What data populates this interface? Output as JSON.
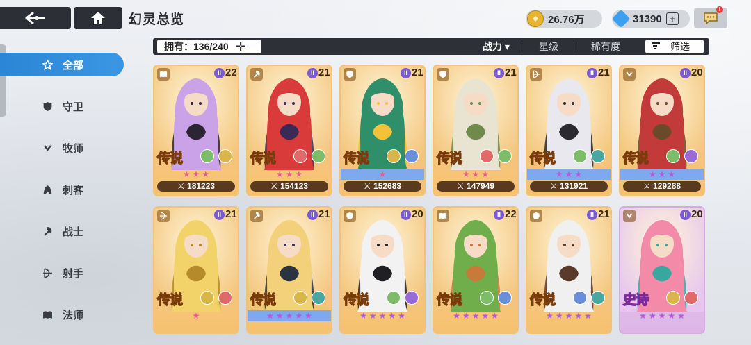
{
  "header": {
    "title": "幻灵总览",
    "gold": "26.76万",
    "gems": "31390",
    "notification_mark": "!"
  },
  "sidebar": {
    "items": [
      {
        "label": "全部",
        "icon": "star-outline-icon",
        "active": true
      },
      {
        "label": "守卫",
        "icon": "shield-icon",
        "active": false
      },
      {
        "label": "牧师",
        "icon": "wings-icon",
        "active": false
      },
      {
        "label": "刺客",
        "icon": "hood-icon",
        "active": false
      },
      {
        "label": "战士",
        "icon": "axe-icon",
        "active": false
      },
      {
        "label": "射手",
        "icon": "bow-icon",
        "active": false
      },
      {
        "label": "法师",
        "icon": "book-icon",
        "active": false
      }
    ]
  },
  "filter_bar": {
    "own_label": "拥有：136/240",
    "sort_options": [
      {
        "label": "战力 ▾",
        "active": true
      },
      {
        "label": "星级",
        "active": false
      },
      {
        "label": "稀有度",
        "active": false
      }
    ],
    "filter_label": "筛选"
  },
  "colors": {
    "accent_blue": "#2a86d6",
    "legend_card": "#f6c170",
    "epic_card": "#dcb6e6",
    "pink_star": "#e85a8a",
    "purple_star": "#b45ad8"
  },
  "cards": [
    {
      "level": "22",
      "rarity": "传说",
      "power": "181223",
      "stars": 3,
      "star_color": "pink",
      "strip": "plain",
      "cls_icon": "book-icon",
      "elements": [
        "leaf",
        "wings"
      ],
      "palette": [
        "#c9a2e8",
        "#2b2433"
      ]
    },
    {
      "level": "21",
      "rarity": "传说",
      "power": "154123",
      "stars": 3,
      "star_color": "pink",
      "strip": "plain",
      "cls_icon": "axe-icon",
      "elements": [
        "spiral",
        "leaf"
      ],
      "palette": [
        "#d93b3b",
        "#3a2a55"
      ]
    },
    {
      "level": "21",
      "rarity": "传说",
      "power": "152683",
      "stars": 1,
      "star_color": "pink",
      "strip": "blue",
      "cls_icon": "shield-icon",
      "elements": [
        "wings",
        "gear"
      ],
      "palette": [
        "#2f8f6a",
        "#f1c23a"
      ]
    },
    {
      "level": "21",
      "rarity": "传说",
      "power": "147949",
      "stars": 3,
      "star_color": "pink",
      "strip": "plain",
      "cls_icon": "shield-icon",
      "elements": [
        "spiral",
        "leaf"
      ],
      "palette": [
        "#e9e4d2",
        "#6f8a4a"
      ]
    },
    {
      "level": "21",
      "rarity": "传说",
      "power": "131921",
      "stars": 3,
      "star_color": "purple",
      "strip": "blue",
      "cls_icon": "bow-icon",
      "elements": [
        "leaf",
        "orb"
      ],
      "palette": [
        "#e8e8ee",
        "#2a2a30"
      ]
    },
    {
      "level": "20",
      "rarity": "传说",
      "power": "129288",
      "stars": 3,
      "star_color": "purple",
      "strip": "blue",
      "cls_icon": "wings-icon",
      "elements": [
        "leaf",
        "eye"
      ],
      "palette": [
        "#c23a3a",
        "#6a4a2a"
      ]
    },
    {
      "level": "21",
      "rarity": "传说",
      "power": "",
      "stars": 1,
      "star_color": "pink",
      "strip": "plain",
      "cls_icon": "bow-icon",
      "elements": [
        "wings",
        "spiral"
      ],
      "palette": [
        "#f1d36a",
        "#b48a2a"
      ]
    },
    {
      "level": "21",
      "rarity": "传说",
      "power": "",
      "stars": 5,
      "star_color": "purple",
      "strip": "blue",
      "cls_icon": "axe-icon",
      "elements": [
        "wings",
        "orb"
      ],
      "palette": [
        "#f3d07a",
        "#2c3340"
      ]
    },
    {
      "level": "20",
      "rarity": "传说",
      "power": "",
      "stars": 5,
      "star_color": "purple",
      "strip": "plain",
      "cls_icon": "shield-icon",
      "elements": [
        "leaf",
        "eye"
      ],
      "palette": [
        "#f2f2f2",
        "#1f1f24"
      ]
    },
    {
      "level": "22",
      "rarity": "传说",
      "power": "",
      "stars": 5,
      "star_color": "purple",
      "strip": "plain",
      "cls_icon": "book-icon",
      "elements": [
        "leaf",
        "gear"
      ],
      "palette": [
        "#6fae4a",
        "#c87a3a"
      ]
    },
    {
      "level": "21",
      "rarity": "传说",
      "power": "",
      "stars": 5,
      "star_color": "purple",
      "strip": "plain",
      "cls_icon": "shield-icon",
      "elements": [
        "gear",
        "orb"
      ],
      "palette": [
        "#f0f0f0",
        "#5a3a2a"
      ]
    },
    {
      "level": "20",
      "rarity": "史诗",
      "power": "",
      "stars": 5,
      "star_color": "purple",
      "strip": "plain",
      "cls_icon": "wings-icon",
      "elements": [
        "wings",
        "spiral"
      ],
      "palette": [
        "#f28aa8",
        "#3aa6a0"
      ],
      "epic": true
    }
  ]
}
